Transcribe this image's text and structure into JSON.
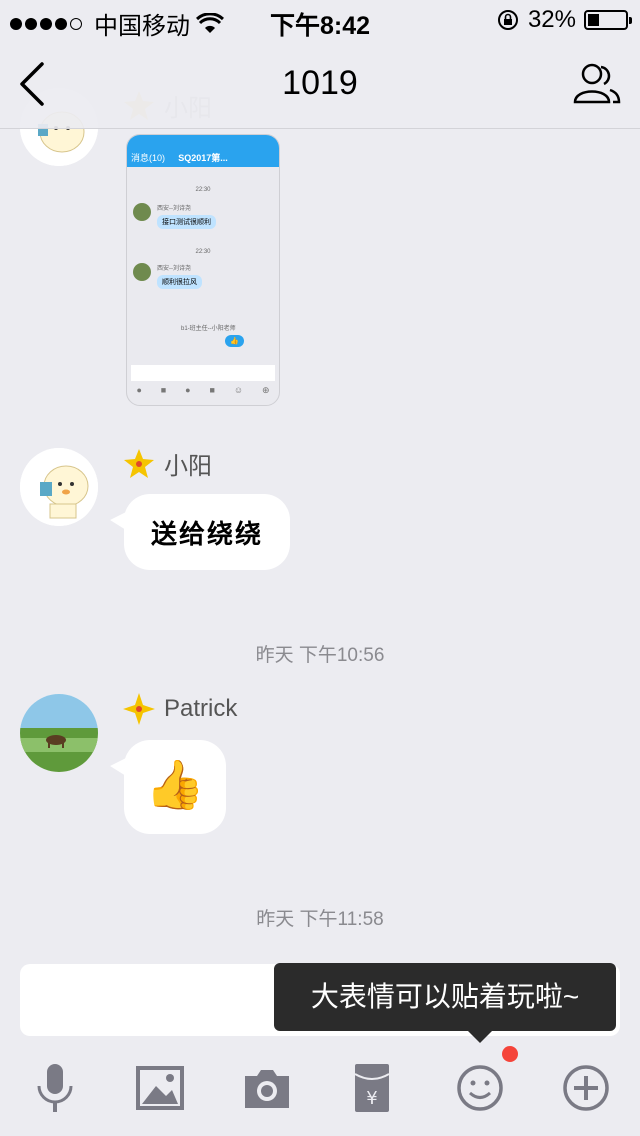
{
  "status_bar": {
    "carrier": "中国移动",
    "time": "下午8:42",
    "battery": "32%"
  },
  "nav": {
    "title": "1019"
  },
  "messages": [
    {
      "sender": "小阳",
      "type": "image"
    },
    {
      "sender": "小阳",
      "type": "sticker",
      "text": "送给绕绕"
    },
    {
      "timestamp": "昨天 下午10:56"
    },
    {
      "sender": "Patrick",
      "type": "emoji",
      "text": "👍"
    },
    {
      "timestamp": "昨天 下午11:58"
    }
  ],
  "embedded_screenshot": {
    "title": "SQ2017第...",
    "back_label": "消息(10)",
    "time_labels": [
      "22:30",
      "22:30"
    ],
    "name_1": "西安--刘诗尧",
    "msg_1": "接口测试很顺利",
    "name_2": "西安--刘诗尧",
    "msg_2": "顺利很拉风",
    "name_3": "b1-班主任--小阳老师"
  },
  "tooltip": {
    "text": "大表情可以贴着玩啦~"
  },
  "toolbar": {
    "icons": [
      "microphone-icon",
      "image-icon",
      "camera-icon",
      "red-packet-icon",
      "emoji-icon",
      "plus-icon"
    ]
  },
  "colors": {
    "background": "#ececf1",
    "accent_blue": "#2aa3ee",
    "badge_red": "#f5443a",
    "star_yellow": "#f5c400"
  }
}
